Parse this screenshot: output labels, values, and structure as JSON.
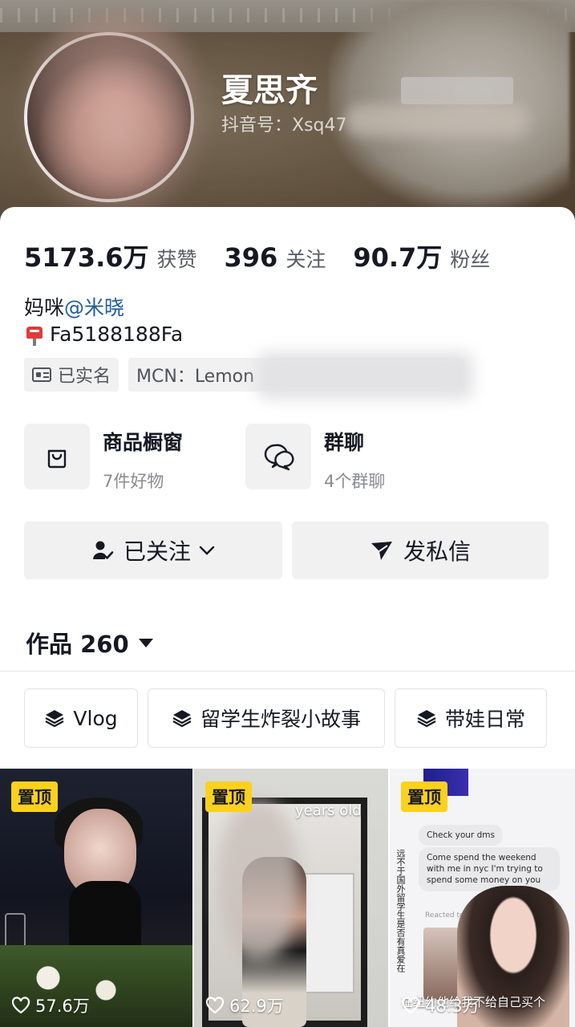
{
  "profile": {
    "name": "夏思齐",
    "douyin_id": "抖音号：Xsq47"
  },
  "stats": [
    {
      "value": "5173.6万",
      "label": "获赞"
    },
    {
      "value": "396",
      "label": "关注"
    },
    {
      "value": "90.7万",
      "label": "粉丝"
    }
  ],
  "bio": {
    "line1_prefix": "妈咪",
    "line1_mention": "@米晓",
    "line2": "Fa5188188Fa"
  },
  "tags": {
    "verified": "已实名",
    "mcn": "MCN：Lemon"
  },
  "features": {
    "shop": {
      "title": "商品橱窗",
      "sub": "7件好物",
      "icon": "shopping-bag-icon"
    },
    "group": {
      "title": "群聊",
      "sub": "4个群聊",
      "icon": "chat-bubbles-icon"
    }
  },
  "actions": {
    "following": "已关注",
    "message": "发私信"
  },
  "works": {
    "title": "作品 260"
  },
  "collections": [
    {
      "label": "Vlog"
    },
    {
      "label": "留学生炸裂小故事"
    },
    {
      "label": "带娃日常"
    }
  ],
  "videos": [
    {
      "pin": "置顶",
      "likes": "57.6万"
    },
    {
      "pin": "置顶",
      "likes": "62.9万",
      "overlay": "years old"
    },
    {
      "pin": "置顶",
      "likes": "48.3万",
      "chat_1": "Check your dms",
      "chat_2": "Come spend the weekend with me in nyc I'm trying to spend some money on you",
      "reacted": "Reacted to you",
      "caption": "在纽约他给我不给自己买个",
      "side_text": "远不于国外留学生是否有真爱在"
    }
  ],
  "colors": {
    "accent_pin": "#fbd11c",
    "mention": "#1f5c9c",
    "chip_bg": "#f1f1f2"
  }
}
